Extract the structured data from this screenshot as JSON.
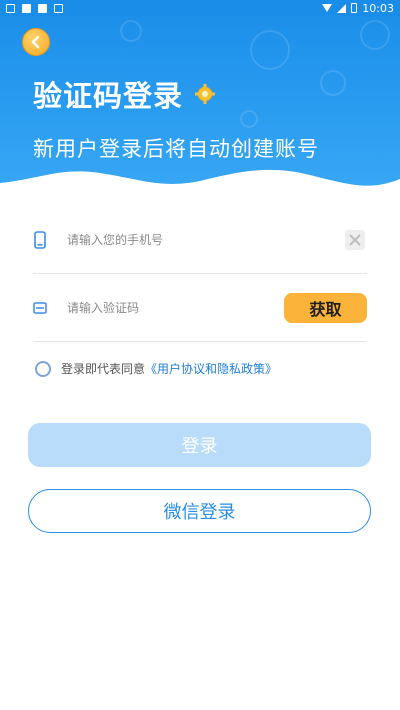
{
  "status_bar": {
    "time": "10:03"
  },
  "header": {
    "title": "验证码登录",
    "subtitle": "新用户登录后将自动创建账号"
  },
  "form": {
    "phone": {
      "placeholder": "请输入您的手机号",
      "value": ""
    },
    "code": {
      "placeholder": "请输入验证码",
      "value": ""
    },
    "get_code_label": "获取"
  },
  "agreement": {
    "prefix": "登录即代表同意",
    "link": "《用户协议和隐私政策》"
  },
  "buttons": {
    "login": "登录",
    "wechat_login": "微信登录"
  },
  "colors": {
    "header_blue": "#1a8de9",
    "accent_orange": "#fbb33a",
    "login_disabled": "#b9dcfb",
    "link_blue": "#1f7fd8"
  }
}
